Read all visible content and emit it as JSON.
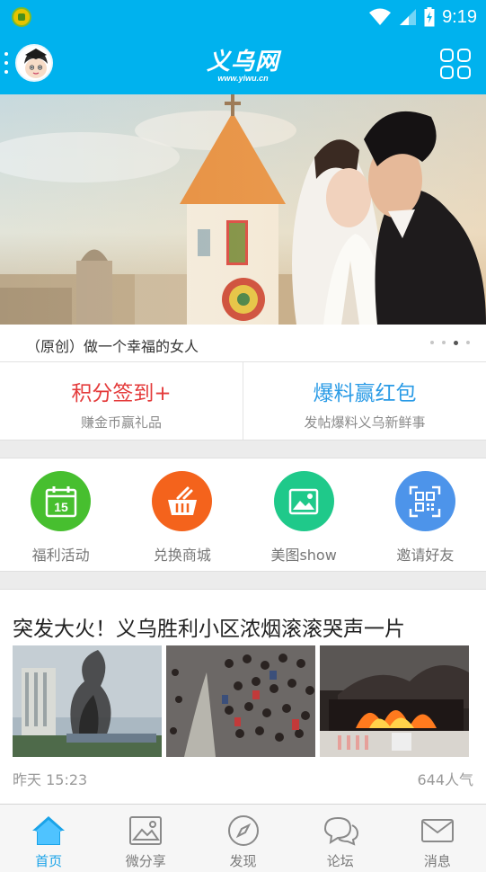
{
  "status_bar": {
    "time": "9:19"
  },
  "header": {
    "logo": "义乌网",
    "logo_sub": "www.yiwu.cn"
  },
  "banner": {
    "caption": "（原创）做一个幸福的女人",
    "active_dot": 3,
    "dot_count": 4
  },
  "promo": [
    {
      "title": "积分签到+",
      "subtitle": "赚金币赢礼品",
      "color": "#e43a3a"
    },
    {
      "title": "爆料赢红包",
      "subtitle": "发帖爆料义乌新鲜事",
      "color": "#2a9be6"
    }
  ],
  "quick_nav": [
    {
      "label": "福利活动",
      "icon": "calendar-icon",
      "color": "#47bf2f",
      "calendar_day": "15"
    },
    {
      "label": "兑换商城",
      "icon": "basket-icon",
      "color": "#f4631c"
    },
    {
      "label": "美图show",
      "icon": "image-icon",
      "color": "#1fc98a"
    },
    {
      "label": "邀请好友",
      "icon": "qrcode-icon",
      "color": "#4d94ea"
    }
  ],
  "news": {
    "title": "突发大火！义乌胜利小区浓烟滚滚哭声一片",
    "time": "昨天  15:23",
    "views": "644人气"
  },
  "tabs": [
    {
      "label": "首页",
      "icon": "home-icon",
      "active": true
    },
    {
      "label": "微分享",
      "icon": "picture-icon",
      "active": false
    },
    {
      "label": "发现",
      "icon": "compass-icon",
      "active": false
    },
    {
      "label": "论坛",
      "icon": "chat-icon",
      "active": false
    },
    {
      "label": "消息",
      "icon": "mail-icon",
      "active": false
    }
  ],
  "colors": {
    "brand": "#00b2ee",
    "active_tab": "#1aa3e8"
  }
}
